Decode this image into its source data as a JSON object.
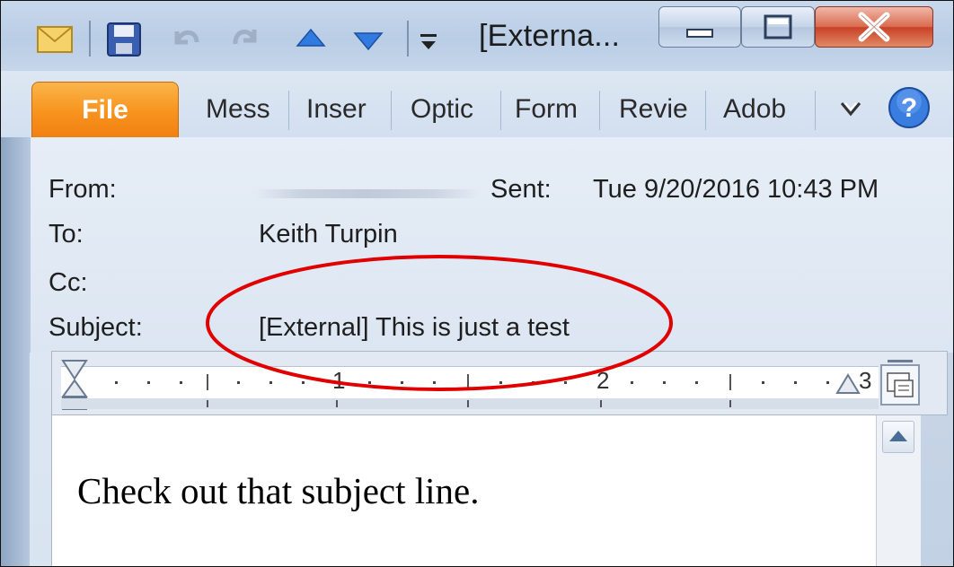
{
  "window": {
    "title": "[Externa...",
    "qat_icons": [
      "mail-icon",
      "save-icon",
      "undo-icon",
      "redo-icon",
      "previous-item-icon",
      "next-item-icon",
      "customize-qat-icon"
    ],
    "controls": [
      "minimize-icon",
      "maximize-icon",
      "close-icon"
    ]
  },
  "ribbon": {
    "file_label": "File",
    "tabs": [
      "Mess",
      "Inser",
      "Optic",
      "Form",
      "Revie",
      "Adob"
    ],
    "file_color": "#f7931e"
  },
  "header": {
    "from_label": "From:",
    "from_value": "",
    "sent_label": "Sent:",
    "sent_value": "Tue 9/20/2016 10:43 PM",
    "to_label": "To:",
    "to_value": "Keith Turpin",
    "cc_label": "Cc:",
    "cc_value": "",
    "subject_label": "Subject:",
    "subject_value": "[External] This is just a test"
  },
  "ruler": {
    "marks": [
      "1",
      "2",
      "3"
    ]
  },
  "body": {
    "text": "Check out that subject line."
  },
  "annotation": {
    "color": "#e00000",
    "shape": "ellipse around subject line"
  }
}
